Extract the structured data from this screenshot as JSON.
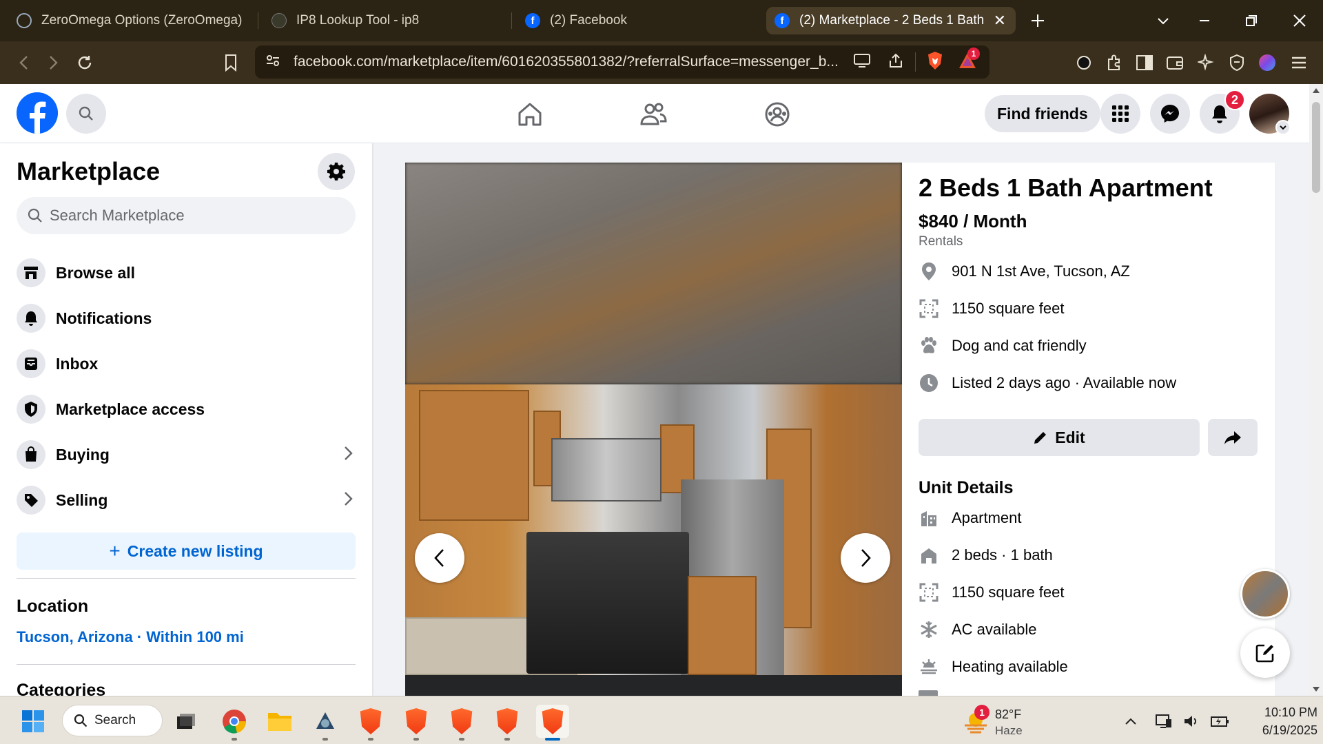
{
  "browser": {
    "tabs": [
      {
        "title": "ZeroOmega Options (ZeroOmega)"
      },
      {
        "title": "IP8 Lookup Tool - ip8"
      },
      {
        "title": "(2) Facebook"
      },
      {
        "title": "(2) Marketplace - 2 Beds 1 Bath /"
      }
    ],
    "url": "facebook.com/marketplace/item/601620355801382/?referralSurface=messenger_b...",
    "brave_rewards_badge": "1"
  },
  "fb_header": {
    "find_friends_label": "Find friends",
    "notification_count": "2"
  },
  "sidebar": {
    "title": "Marketplace",
    "search_placeholder": "Search Marketplace",
    "items": [
      {
        "label": "Browse all",
        "icon": "storefront-icon"
      },
      {
        "label": "Notifications",
        "icon": "bell-icon"
      },
      {
        "label": "Inbox",
        "icon": "inbox-icon"
      },
      {
        "label": "Marketplace access",
        "icon": "shield-icon"
      },
      {
        "label": "Buying",
        "icon": "bag-icon"
      },
      {
        "label": "Selling",
        "icon": "tag-icon"
      }
    ],
    "create_listing_label": "Create new listing",
    "location_heading": "Location",
    "location_value": "Tucson, Arizona · Within 100 mi",
    "categories_heading": "Categories"
  },
  "listing": {
    "title": "2 Beds 1 Bath Apartment",
    "price": "$840 / Month",
    "category": "Rentals",
    "facts": [
      {
        "text": "901 N 1st Ave, Tucson, AZ",
        "icon": "location-pin-icon"
      },
      {
        "text": "1150 square feet",
        "icon": "expand-icon"
      },
      {
        "text": "Dog and cat friendly",
        "icon": "paw-icon"
      },
      {
        "text": "Listed 2 days ago · Available now",
        "icon": "clock-icon"
      }
    ],
    "edit_label": "Edit",
    "unit_details_heading": "Unit Details",
    "unit_details": [
      {
        "text": "Apartment",
        "icon": "building-icon"
      },
      {
        "text": "2 beds · 1 bath",
        "icon": "bed-icon"
      },
      {
        "text": "1150 square feet",
        "icon": "expand-icon"
      },
      {
        "text": "AC available",
        "icon": "snowflake-icon"
      },
      {
        "text": "Heating available",
        "icon": "heat-icon"
      }
    ]
  },
  "taskbar": {
    "search_label": "Search",
    "weather_temp": "82°F",
    "weather_desc": "Haze",
    "weather_badge": "1",
    "time": "10:10 PM",
    "date": "6/19/2025"
  },
  "colors": {
    "fb_blue": "#0866ff",
    "link_blue": "#0064d1",
    "badge_red": "#e41e3f",
    "browser_chrome": "#2b2314"
  }
}
